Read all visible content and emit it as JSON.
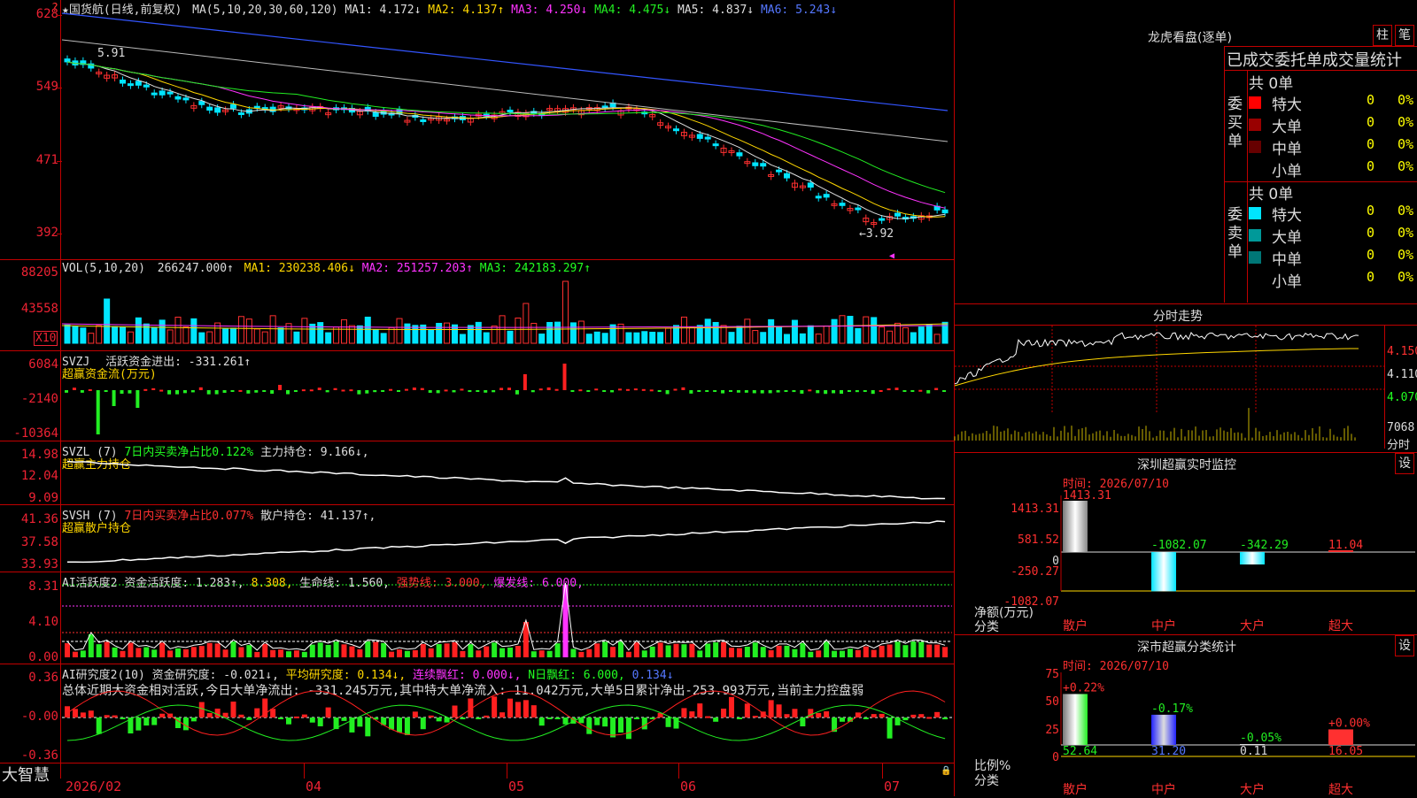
{
  "main": {
    "title": "★国货航(日线,前复权)",
    "ma_label": "MA(5,10,20,30,60,120)",
    "ma_values": [
      {
        "label": "MA1: 4.172↓",
        "color": "#dddddd"
      },
      {
        "label": "MA2: 4.137↑",
        "color": "#ffd700"
      },
      {
        "label": "MA3: 4.250↓",
        "color": "#ff33ff"
      },
      {
        "label": "MA4: 4.475↓",
        "color": "#22ee22"
      },
      {
        "label": "MA5: 4.837↓",
        "color": "#dddddd"
      },
      {
        "label": "MA6: 5.243↓",
        "color": "#5577ff"
      }
    ],
    "yticks": [
      "628",
      "549",
      "471",
      "392"
    ],
    "high_label": "5.91",
    "low_label": "←3.92",
    "top_marker": "?"
  },
  "vol": {
    "label": "VOL(5,10,20)",
    "value": "266247.000↑",
    "ma1": "MA1: 230238.406↓",
    "ma2": "MA2: 251257.203↑",
    "ma3": "MA3: 242183.297↑",
    "yticks": [
      "88205",
      "43558"
    ],
    "unit": "X10"
  },
  "svzj": {
    "label": "SVZJ",
    "desc": "活跃资金进出: -331.261↑",
    "sub": "超赢资金流(万元)",
    "yticks": [
      "6084",
      "-2140",
      "-10364"
    ]
  },
  "svzl": {
    "label": "SVZL (7)",
    "desc": "7日内买卖净占比0.122%",
    "extra": "主力持仓: 9.166↓,",
    "sub": "超赢主力持仓",
    "yticks": [
      "14.98",
      "12.04",
      "9.09"
    ]
  },
  "svsh": {
    "label": "SVSH (7)",
    "desc": "7日内买卖净占比0.077%",
    "extra": "散户持仓: 41.137↑,",
    "sub": "超赢散户持仓",
    "yticks": [
      "41.36",
      "37.58",
      "33.93"
    ]
  },
  "ai1": {
    "label": "AI活跃度2",
    "desc": "资金活跃度: 1.283↑,",
    "v2": "8.308,",
    "life": "生命线: 1.560,",
    "strong": "强势线: 3.000,",
    "burst": "爆发线: 6.000,",
    "yticks": [
      "8.31",
      "4.10",
      "0.00"
    ]
  },
  "ai2": {
    "label": "AI研究度2(10)",
    "desc": "资金研究度: -0.021↓,",
    "avg": "平均研究度: 0.134↓,",
    "lianxu": "连续飘红: 0.000↓,",
    "nday": "N日飘红: 6.000,",
    "nval": "0.134↓",
    "summary": "总体近期大资金相对活跃,今日大单净流出: -331.245万元,其中特大单净流入: 11.042万元,大单5日累计净出-253.993万元,当前主力控盘弱",
    "yticks": [
      "0.36",
      "-0.00",
      "-0.36"
    ]
  },
  "dates": [
    "2026/02",
    "04",
    "05",
    "06",
    "07"
  ],
  "brand": "大智慧",
  "lhb": {
    "title": "龙虎看盘(逐单)",
    "btn1": "柱",
    "btn2": "笔",
    "header": "已成交委托单成交量统计",
    "buy_side": "委买单",
    "sell_side": "委卖单",
    "buy_total": "共 0单",
    "sell_total": "共 0单",
    "buy_rows": [
      {
        "name": "特大",
        "v": "0",
        "p": "0%",
        "color": "#ff0000"
      },
      {
        "name": "大单",
        "v": "0",
        "p": "0%",
        "color": "#990000"
      },
      {
        "name": "中单",
        "v": "0",
        "p": "0%",
        "color": "#660000"
      },
      {
        "name": "小单",
        "v": "0",
        "p": "0%",
        "color": ""
      }
    ],
    "sell_rows": [
      {
        "name": "特大",
        "v": "0",
        "p": "0%",
        "color": "#00e5ff"
      },
      {
        "name": "大单",
        "v": "0",
        "p": "0%",
        "color": "#009999"
      },
      {
        "name": "中单",
        "v": "0",
        "p": "0%",
        "color": "#007777"
      },
      {
        "name": "小单",
        "v": "0",
        "p": "0%",
        "color": ""
      }
    ]
  },
  "fenshi": {
    "title": "分时走势",
    "yticks": [
      "4.150",
      "4.110",
      "4.070"
    ],
    "vol": "7068",
    "vol_label": "分时"
  },
  "sz_monitor": {
    "title": "深圳超赢实时监控",
    "btn": "设",
    "time": "时间: 2026/07/10",
    "yticks": [
      "1413.31",
      "581.52",
      "0",
      "-250.27",
      "-1082.07"
    ],
    "ylabel1": "净额(万元)",
    "ylabel2": "分类",
    "categories": [
      "散户",
      "中户",
      "大户",
      "超大"
    ],
    "values": [
      "1413.31",
      "-1082.07",
      "-342.29",
      "11.04"
    ]
  },
  "sz_class": {
    "title": "深市超赢分类统计",
    "btn": "设",
    "time": "时间: 2026/07/10",
    "yticks": [
      "75",
      "50",
      "25",
      "0"
    ],
    "ylabel1": "比例%",
    "ylabel2": "分类",
    "categories": [
      "散户",
      "中户",
      "大户",
      "超大"
    ],
    "changes": [
      "+0.22%",
      "-0.17%",
      "-0.05%",
      "+0.00%"
    ],
    "values": [
      "52.64",
      "31.20",
      "0.11",
      "16.05"
    ]
  }
}
